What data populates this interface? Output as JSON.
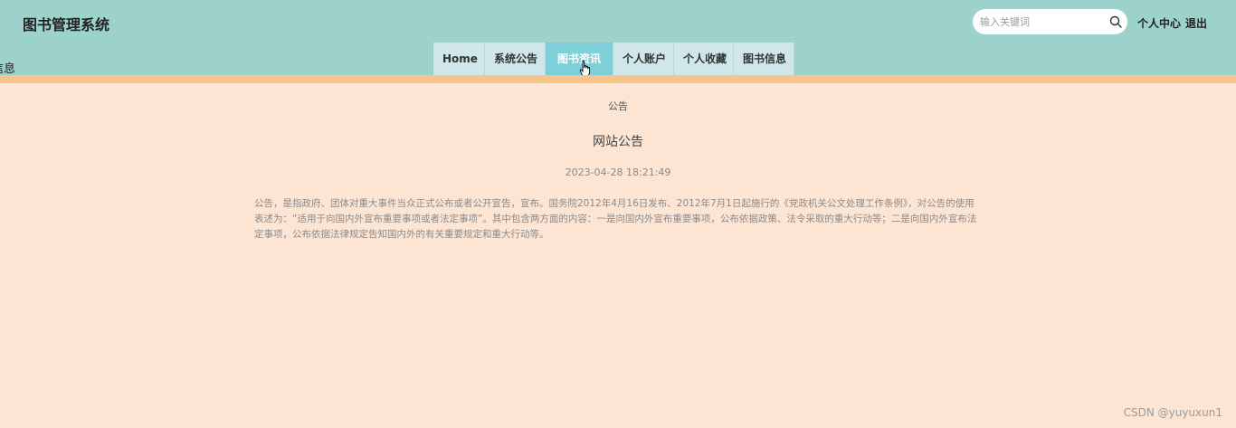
{
  "header": {
    "brand": "图书管理系统",
    "stray_text": "信息",
    "search": {
      "placeholder": "输入关键词",
      "value": ""
    },
    "user_center": "个人中心",
    "logout": "退出"
  },
  "nav": {
    "tabs": [
      {
        "label": "Home"
      },
      {
        "label": "系统公告"
      },
      {
        "label": "图书资讯",
        "active": true
      },
      {
        "label": "个人账户"
      },
      {
        "label": "个人收藏"
      },
      {
        "label": "图书信息"
      }
    ]
  },
  "content": {
    "breadcrumb": "公告",
    "title": "网站公告",
    "date": "2023-04-28 18:21:49",
    "paragraph": "公告，是指政府、团体对重大事件当众正式公布或者公开宣告，宣布。国务院2012年4月16日发布、2012年7月1日起施行的《党政机关公文处理工作条例》，对公告的使用表述为：“适用于向国内外宣布重要事项或者法定事项”。其中包含两方面的内容：一是向国内外宣布重要事项，公布依据政策、法令采取的重大行动等；二是向国内外宣布法定事项，公布依据法律规定告知国内外的有关重要规定和重大行动等。"
  },
  "watermark": "CSDN @yuyuxun1",
  "colors": {
    "header_bg": "#9cd2cb",
    "accent_stripe": "#f7c48a",
    "page_bg": "#fde5d4",
    "active_tab": "#7fcfd8"
  }
}
